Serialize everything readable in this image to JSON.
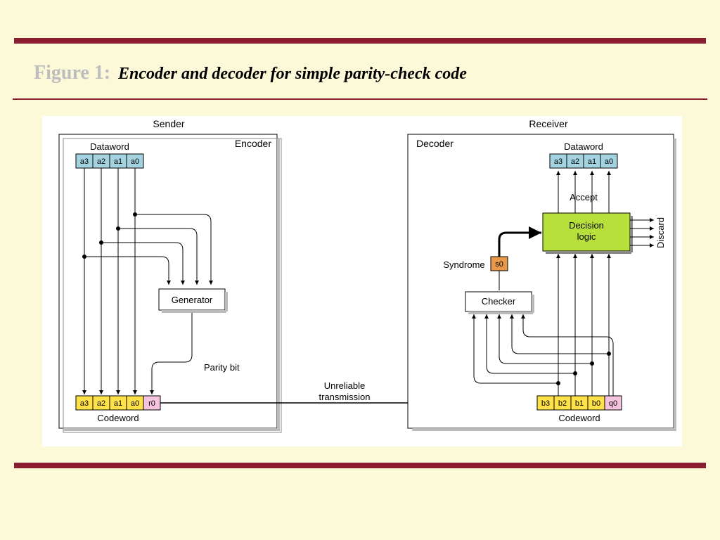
{
  "figure_number": "Figure 1:",
  "caption": "Encoder and decoder for simple parity-check code",
  "sender": {
    "title": "Sender",
    "block": "Encoder",
    "dataword_label": "Dataword",
    "dataword_bits": [
      "a3",
      "a2",
      "a1",
      "a0"
    ],
    "generator": "Generator",
    "parity_label": "Parity bit",
    "codeword_label": "Codeword",
    "codeword_bits": [
      "a3",
      "a2",
      "a1",
      "a0",
      "r0"
    ]
  },
  "channel_label": "Unreliable\ntransmission",
  "receiver": {
    "title": "Receiver",
    "block": "Decoder",
    "dataword_label": "Dataword",
    "dataword_bits": [
      "a3",
      "a2",
      "a1",
      "a0"
    ],
    "accept_label": "Accept",
    "decision_label": "Decision\nlogic",
    "discard_label": "Discard",
    "syndrome_label": "Syndrome",
    "syndrome_bit": "s0",
    "checker": "Checker",
    "codeword_label": "Codeword",
    "codeword_bits": [
      "b3",
      "b2",
      "b1",
      "b0",
      "q0"
    ]
  }
}
